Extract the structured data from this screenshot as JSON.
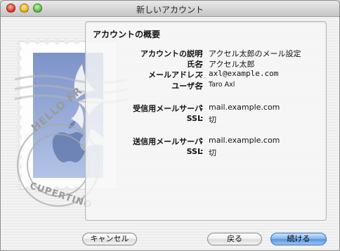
{
  "window": {
    "title": "新しいアカウント"
  },
  "summary": {
    "title": "アカウントの概要",
    "rows": [
      {
        "label": "アカウントの説明",
        "value": "アクセル太郎のメール設定"
      },
      {
        "label": "氏名",
        "value": "アクセル太郎"
      },
      {
        "label": "メールアドレス",
        "value": "axl@example.com"
      },
      {
        "label": "ユーザ名",
        "value": "Taro Axl"
      },
      {
        "label": "受信用メールサーバ",
        "value": "mail.example.com"
      },
      {
        "label": "SSL",
        "value": "切"
      },
      {
        "label": "送信用メールサーバ",
        "value": "mail.example.com"
      },
      {
        "label": "SSL",
        "value": "切"
      }
    ]
  },
  "stamp": {
    "text_top": "HELLO FR",
    "text_bottom": "CUPERTINO"
  },
  "buttons": {
    "cancel": "キャンセル",
    "back": "戻る",
    "next": "続ける"
  }
}
